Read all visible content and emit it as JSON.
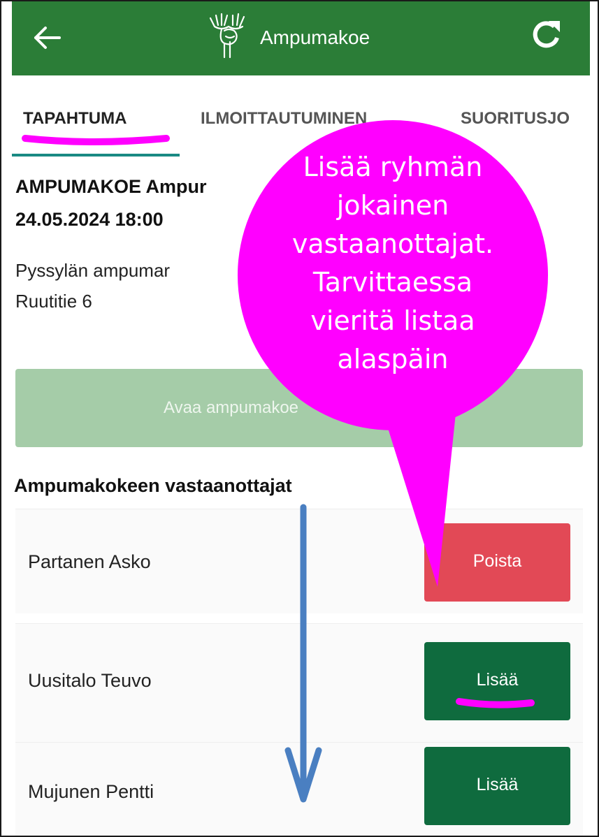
{
  "appbar": {
    "title": "Ampumakoe",
    "back_icon": "arrow-left-icon",
    "logo_icon": "moose-logo-icon",
    "refresh_icon": "refresh-icon",
    "bg_color": "#2b7d37"
  },
  "tabs": [
    {
      "label": "TAPAHTUMA",
      "active": true
    },
    {
      "label": "ILMOITTAUTUMINEN",
      "active": false
    },
    {
      "label": "SUORITUSJO",
      "active": false
    }
  ],
  "event": {
    "title": "AMPUMAKOE Ampur",
    "datetime": "24.05.2024 18:00",
    "place": "Pyssylän ampumar",
    "street": "Ruutitie 6"
  },
  "open_button": {
    "label": "Avaa ampumakoe"
  },
  "recipients": {
    "heading": "Ampumakokeen vastaanottajat",
    "rows": [
      {
        "name": "Partanen Asko",
        "action": "Poista"
      },
      {
        "name": "Uusitalo Teuvo",
        "action": "Lisää"
      },
      {
        "name": "Mujunen Pentti",
        "action": "Lisää"
      }
    ]
  },
  "annotation": {
    "callout_lines": [
      "Lisää ryhmän",
      "jokainen",
      "vastaanottajat.",
      "Tarvittaessa",
      "vieritä listaa",
      "alaspäin"
    ],
    "callout_color": "#ff00ff",
    "arrow_color": "#4a7fc1"
  },
  "colors": {
    "remove": "#e24956",
    "add": "#0f6b3e",
    "open_disabled": "#a5cca8",
    "tab_indicator": "#1a8a83"
  }
}
